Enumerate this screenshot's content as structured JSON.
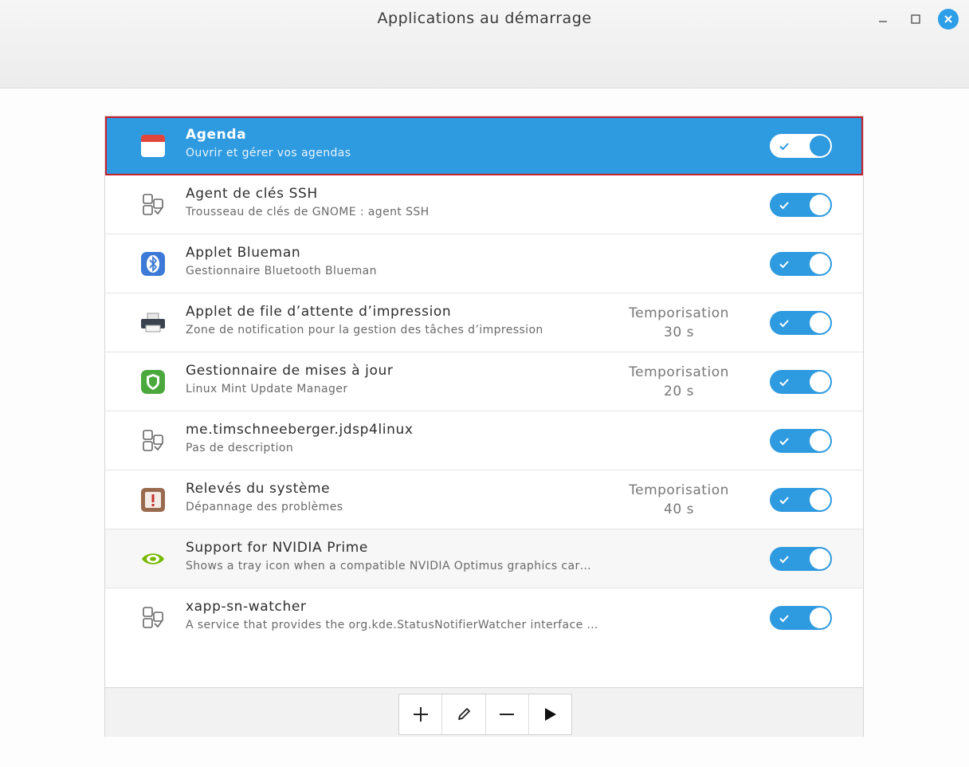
{
  "window": {
    "title": "Applications au démarrage"
  },
  "apps": [
    {
      "name": "Agenda",
      "description": "Ouvrir et gérer vos agendas",
      "delay_label": "",
      "delay_value": "",
      "enabled": true,
      "selected": true,
      "icon": "calendar-icon"
    },
    {
      "name": "Agent de clés SSH",
      "description": "Trousseau de clés de GNOME : agent SSH",
      "delay_label": "",
      "delay_value": "",
      "enabled": true,
      "icon": "generic-app-icon"
    },
    {
      "name": "Applet Blueman",
      "description": "Gestionnaire Bluetooth Blueman",
      "delay_label": "",
      "delay_value": "",
      "enabled": true,
      "icon": "bluetooth-icon"
    },
    {
      "name": "Applet de file d’attente d’impression",
      "description": "Zone de notification pour la gestion des tâches d’impression",
      "delay_label": "Temporisation",
      "delay_value": "30 s",
      "enabled": true,
      "icon": "printer-icon"
    },
    {
      "name": "Gestionnaire de mises à jour",
      "description": "Linux Mint Update Manager",
      "delay_label": "Temporisation",
      "delay_value": "20 s",
      "enabled": true,
      "icon": "shield-icon"
    },
    {
      "name": "me.timschneeberger.jdsp4linux",
      "description": "Pas de description",
      "delay_label": "",
      "delay_value": "",
      "enabled": true,
      "icon": "generic-app-icon"
    },
    {
      "name": "Relevés du système",
      "description": "Dépannage des problèmes",
      "delay_label": "Temporisation",
      "delay_value": "40 s",
      "enabled": true,
      "icon": "warning-report-icon"
    },
    {
      "name": "Support for NVIDIA Prime",
      "description": "Shows a tray icon when a compatible NVIDIA Optimus graphics car…",
      "delay_label": "",
      "delay_value": "",
      "enabled": true,
      "icon": "nvidia-icon"
    },
    {
      "name": "xapp-sn-watcher",
      "description": "A service that provides the org.kde.StatusNotifierWatcher interface …",
      "delay_label": "",
      "delay_value": "",
      "enabled": true,
      "icon": "generic-app-icon"
    }
  ],
  "toolbar": {
    "buttons": [
      "add-icon",
      "edit-icon",
      "remove-icon",
      "run-icon"
    ]
  },
  "colors": {
    "accent": "#2e9ae0",
    "selection_outline": "#c8202a"
  }
}
